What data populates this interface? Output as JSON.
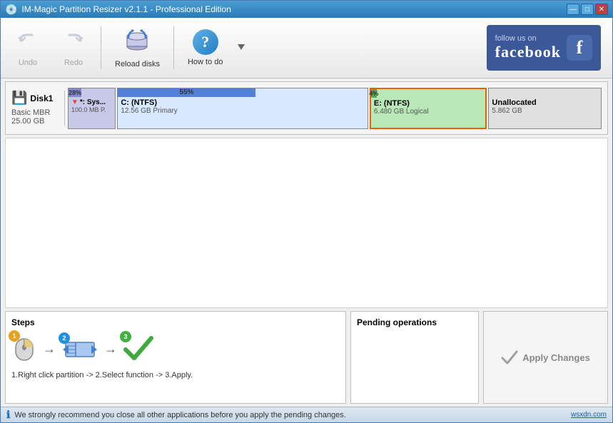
{
  "titlebar": {
    "title": "IM-Magic Partition Resizer v2.1.1 - Professional Edition",
    "icon": "💾"
  },
  "titleControls": {
    "minimize": "—",
    "maximize": "□",
    "close": "✕"
  },
  "toolbar": {
    "undo_label": "Undo",
    "redo_label": "Redo",
    "reload_label": "Reload disks",
    "howto_label": "How to do"
  },
  "facebook": {
    "follow_line1": "follow us on",
    "follow_line2": "facebook",
    "f_letter": "f"
  },
  "disk": {
    "name": "Disk1",
    "type": "Basic MBR",
    "size": "25.00 GB",
    "partitions": [
      {
        "id": "sys",
        "fill_pct": "28%",
        "label": "*: Sys...",
        "fs": "",
        "size": "100.0 MB P.",
        "bar_color": "#8088d0",
        "bg_color": "#c8c8e8",
        "bar_width": "28"
      },
      {
        "id": "c",
        "fill_pct": "55%",
        "label": "C: (NTFS)",
        "fs": "NTFS",
        "size": "12.56 GB Primary",
        "bar_color": "#5080d8",
        "bg_color": "#d8e8ff",
        "bar_width": "55"
      },
      {
        "id": "e",
        "fill_pct": "4%",
        "label": "E: (NTFS)",
        "fs": "NTFS",
        "size": "6.480 GB Logical",
        "bar_color": "#50a850",
        "bg_color": "#b8e8b8",
        "bar_width": "4"
      },
      {
        "id": "unalloc",
        "fill_pct": "",
        "label": "Unallocated",
        "fs": "",
        "size": "5.862 GB",
        "bar_color": "#b0b0b0",
        "bg_color": "#e0e0e0",
        "bar_width": "0"
      }
    ]
  },
  "steps": {
    "title": "Steps",
    "text": "1.Right click partition -> 2.Select function -> 3.Apply.",
    "step1_num": "1",
    "step2_num": "2",
    "step3_num": "3",
    "arrow": "→"
  },
  "pending": {
    "title": "Pending operations"
  },
  "apply": {
    "label": "Apply Changes"
  },
  "statusbar": {
    "message": "We strongly recommend you close all other applications before you apply the pending changes.",
    "website": "wsxdn.com"
  }
}
